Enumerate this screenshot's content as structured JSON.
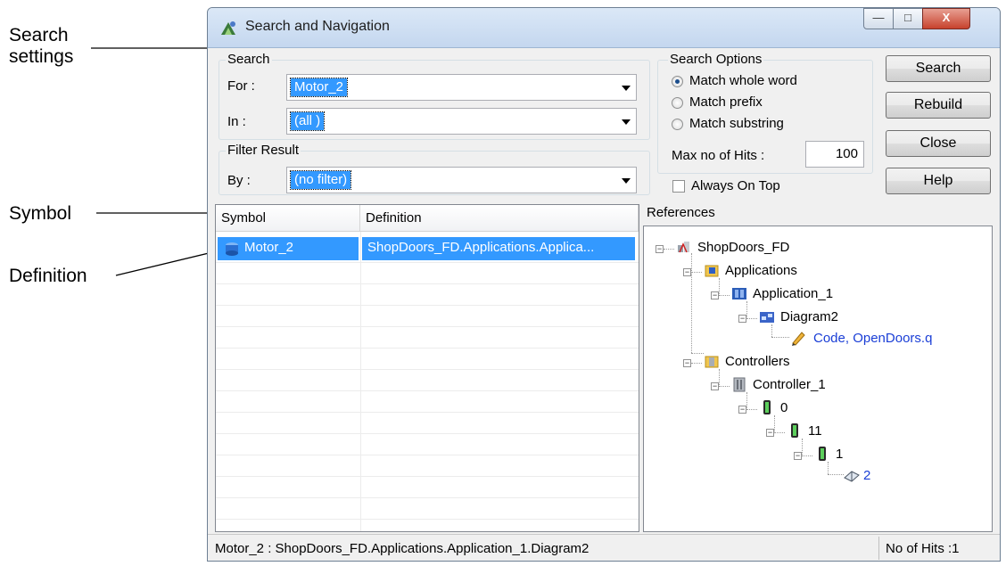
{
  "callouts": {
    "search_settings": [
      "Search",
      "settings"
    ],
    "symbol": "Symbol",
    "definition": "Definition"
  },
  "window": {
    "title": "Search and Navigation",
    "controls": {
      "minimize": "—",
      "maximize": "□",
      "close": "X"
    }
  },
  "search_group": {
    "legend": "Search",
    "for_label": "For :",
    "for_value": "Motor_2",
    "in_label": "In :",
    "in_value": "(all )"
  },
  "filter_group": {
    "legend": "Filter Result",
    "by_label": "By :",
    "by_value": "(no filter)"
  },
  "search_options": {
    "legend": "Search Options",
    "options": [
      "Match whole word",
      "Match prefix",
      "Match substring"
    ],
    "selected_index": 0,
    "max_hits_label": "Max no of Hits :",
    "max_hits_value": "100"
  },
  "always_on_top": {
    "label": "Always On Top",
    "checked": false
  },
  "buttons": {
    "search": "Search",
    "rebuild": "Rebuild",
    "close": "Close",
    "help": "Help"
  },
  "results": {
    "columns": [
      "Symbol",
      "Definition"
    ],
    "rows": [
      {
        "symbol": "Motor_2",
        "definition": "ShopDoors_FD.Applications.Applica..."
      }
    ]
  },
  "references": {
    "title": "References",
    "tree": [
      {
        "label": "ShopDoors_FD",
        "icon": "project-icon"
      },
      {
        "label": "Applications",
        "icon": "applications-folder-icon"
      },
      {
        "label": "Application_1",
        "icon": "application-icon"
      },
      {
        "label": "Diagram2",
        "icon": "diagram-icon"
      },
      {
        "label": "Code, OpenDoors.q",
        "icon": "pencil-icon"
      },
      {
        "label": "Controllers",
        "icon": "controllers-folder-icon"
      },
      {
        "label": "Controller_1",
        "icon": "controller-icon"
      },
      {
        "label": "0",
        "icon": "io-module-icon"
      },
      {
        "label": "11",
        "icon": "io-module-icon"
      },
      {
        "label": "1",
        "icon": "io-module-icon"
      },
      {
        "label": "2",
        "icon": "book-icon"
      }
    ]
  },
  "status": {
    "path": "Motor_2 : ShopDoors_FD.Applications.Application_1.Diagram2",
    "hits": "No of Hits :1"
  },
  "colors": {
    "selection": "#3399ff",
    "link": "#1a3ed6",
    "close_button": "#c7422d"
  }
}
